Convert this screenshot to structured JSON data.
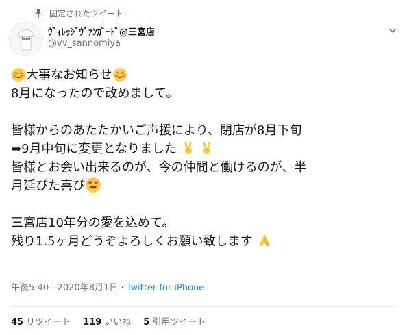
{
  "pinned_label": "固定されたツイート",
  "account": {
    "display_name": "ｳﾞｨﾚｯｼﾞｳﾞｧﾝｶﾞｰﾄﾞ@三宮店",
    "handle": "@vv_sannomiya"
  },
  "tweet": {
    "line1": "大事なお知らせ",
    "line2": "8月になったので改めまして。",
    "line3": "皆様からのあたたかいご声援により、閉店が8月下旬",
    "line4": "➡9月中旬に変更となりました",
    "line5": "皆様とお会い出来るのが、今の仲間と働けるのが、半",
    "line6": "月延びた喜び",
    "line7": "三宮店10年分の愛を込めて。",
    "line8": "残り1.5ヶ月どうぞよろしくお願い致します"
  },
  "meta": {
    "time": "午後5:40",
    "date": "2020年8月1日",
    "separator": "·",
    "source": "Twitter for iPhone"
  },
  "stats": {
    "retweets_count": "45",
    "retweets_label": "リツイート",
    "likes_count": "119",
    "likes_label": "いいね",
    "quotes_count": "5",
    "quotes_label": "引用ツイート"
  },
  "icons": {
    "pin": "pin-icon",
    "more": "chevron-down-icon",
    "emoji_smile": "smiling-face-icon",
    "emoji_victory": "victory-hand-icon",
    "emoji_hearteyes": "heart-eyes-icon",
    "emoji_pray": "folded-hands-icon"
  },
  "colors": {
    "link": "#1b95e0",
    "secondary_text": "#657786",
    "primary_text": "#14171a"
  }
}
